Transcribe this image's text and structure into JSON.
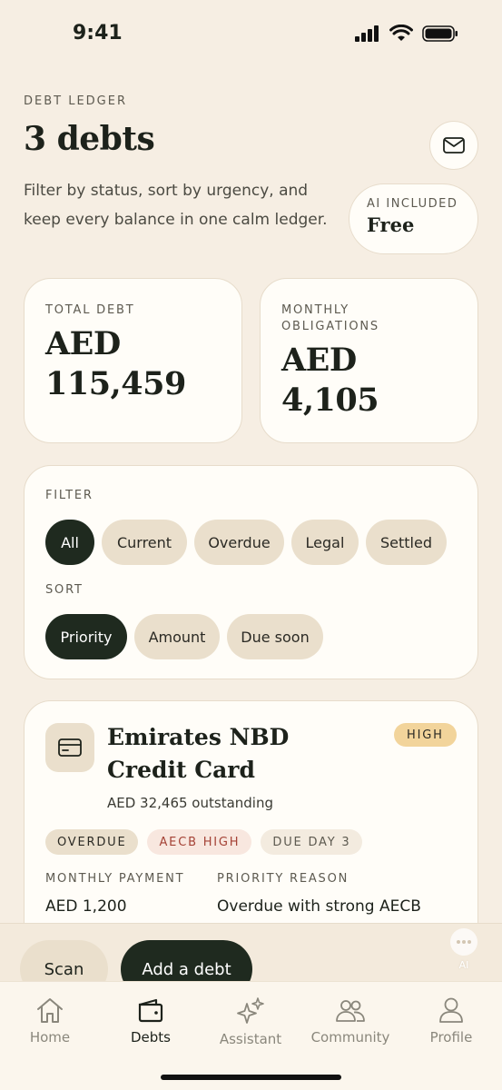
{
  "status_bar": {
    "time": "9:41"
  },
  "header": {
    "eyebrow": "DEBT LEDGER",
    "title": "3 debts",
    "subtitle": "Filter by status, sort by urgency, and keep every balance in one calm ledger.",
    "mail_icon": "mail-icon",
    "ai_chip": {
      "label": "AI INCLUDED",
      "value": "Free"
    }
  },
  "stats": {
    "total": {
      "label": "TOTAL DEBT",
      "value": "AED 115,459"
    },
    "monthly": {
      "label": "MONTHLY OBLIGATIONS",
      "value": "AED 4,105"
    }
  },
  "filter": {
    "filter_label": "FILTER",
    "filters": [
      "All",
      "Current",
      "Overdue",
      "Legal",
      "Settled"
    ],
    "active_filter": "All",
    "sort_label": "SORT",
    "sorts": [
      "Priority",
      "Amount",
      "Due soon"
    ],
    "active_sort": "Priority"
  },
  "debt": {
    "icon": "credit-card-icon",
    "name": "Emirates NBD Credit Card",
    "priority": "HIGH",
    "outstanding": "AED 32,465 outstanding",
    "tags": {
      "overdue": "OVERDUE",
      "aecb": "AECB HIGH",
      "due": "DUE DAY 3"
    },
    "monthly_payment_label": "MONTHLY PAYMENT",
    "monthly_payment_value": "AED 1,200",
    "priority_reason_label": "PRIORITY REASON",
    "priority_reason_value": "Overdue with strong AECB impact."
  },
  "actions": {
    "scan": "Scan",
    "add": "Add a debt",
    "ai_fab_label": "AI"
  },
  "tabs": [
    {
      "label": "Home",
      "icon": "home-icon"
    },
    {
      "label": "Debts",
      "icon": "wallet-icon"
    },
    {
      "label": "Assistant",
      "icon": "sparkles-icon"
    },
    {
      "label": "Community",
      "icon": "people-icon"
    },
    {
      "label": "Profile",
      "icon": "person-icon"
    }
  ],
  "active_tab": "Debts",
  "colors": {
    "background": "#f6eee3",
    "card": "#fffdf8",
    "dark": "#1f2a1f",
    "chip": "#eadfcc",
    "high_badge": "#f2d49b",
    "aecb_text": "#a44236"
  }
}
